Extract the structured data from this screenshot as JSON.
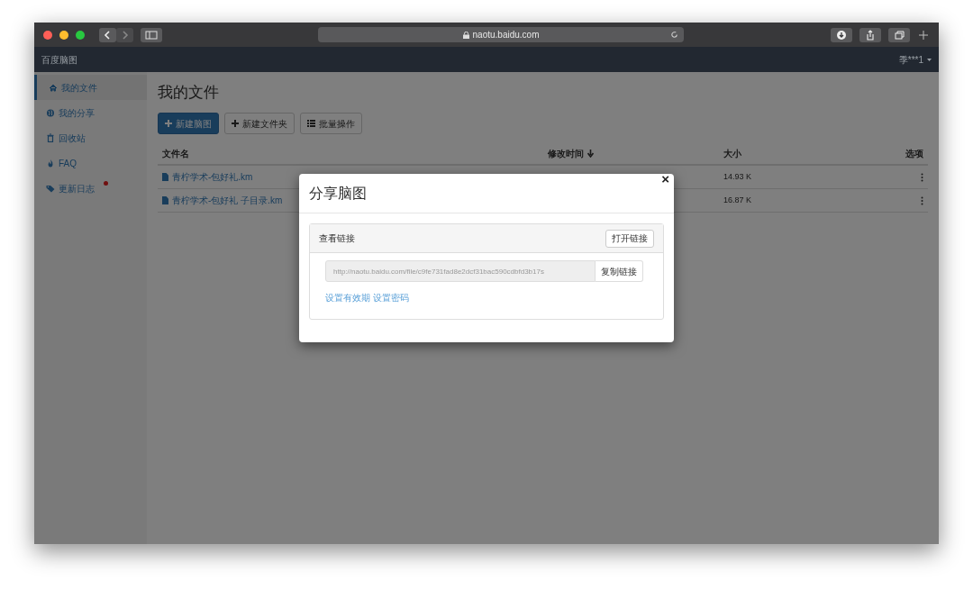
{
  "browser": {
    "url": "naotu.baidu.com"
  },
  "navbar": {
    "brand": "百度脑图",
    "user": "季***1"
  },
  "sidebar": {
    "items": [
      {
        "kind": "home",
        "label": "我的文件",
        "selected": true,
        "dot": false
      },
      {
        "kind": "globe",
        "label": "我的分享",
        "selected": false,
        "dot": false
      },
      {
        "kind": "trash",
        "label": "回收站",
        "selected": false,
        "dot": false
      },
      {
        "kind": "fire",
        "label": "FAQ",
        "selected": false,
        "dot": false
      },
      {
        "kind": "tags",
        "label": "更新日志",
        "selected": false,
        "dot": true
      }
    ]
  },
  "page_title": "我的文件",
  "toolbar": [
    {
      "kind": "new-map",
      "label": "新建脑图"
    },
    {
      "kind": "new-folder",
      "label": "新建文件夹"
    },
    {
      "kind": "batch",
      "label": "批量操作"
    }
  ],
  "table": {
    "columns": [
      "文件名",
      "修改时间",
      "大小",
      "选项"
    ],
    "rows": [
      {
        "name": "青柠学术-包好礼.km",
        "size": "14.93 K"
      },
      {
        "name": "青柠学术-包好礼 子目录.km",
        "size": "16.87 K"
      }
    ]
  },
  "modal": {
    "title": "分享脑图",
    "close": "×",
    "panel_title": "查看链接",
    "open_button": "打开链接",
    "link": "http://naotu.baidu.com/file/c9fe731fad8e2dcf31bac590cdbfd3b17s",
    "copy_button": "复制链接",
    "links": [
      "设置有效期",
      "设置密码"
    ]
  }
}
